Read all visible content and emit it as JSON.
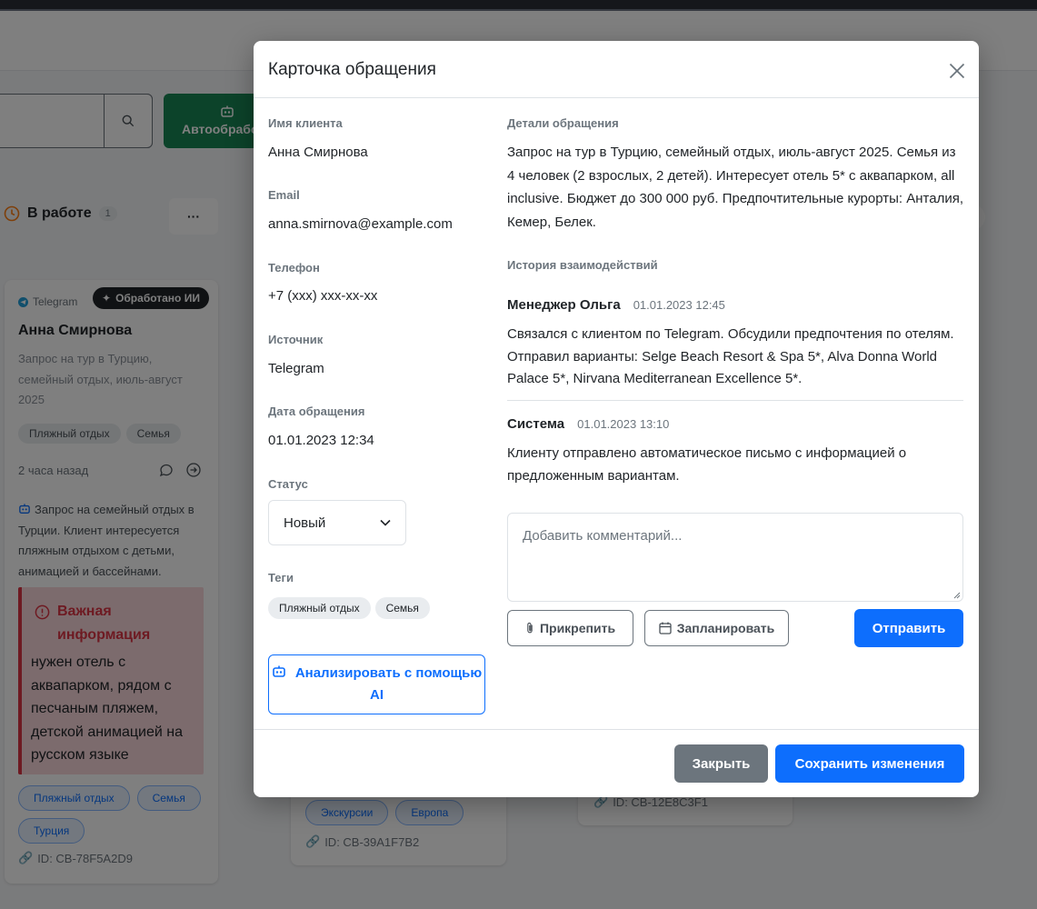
{
  "background": {
    "auto_button_label": "Автообрабо",
    "column": {
      "title": "В работе",
      "count": "1",
      "more_label": "···"
    },
    "lead_card": {
      "source": "Telegram",
      "ai_badge": "Обработано ИИ",
      "name": "Анна Смирнова",
      "description": "Запрос на тур в Турцию, семейный отдых, июль-август 2025",
      "tags": [
        "Пляжный отдых",
        "Семья"
      ],
      "time": "2 часа назад",
      "ai_summary": "Запрос на семейный отдых в Турции. Клиент интересуется пляжным отдыхом с детьми, анимацией и бассейнами.",
      "important_title": "Важная информация",
      "important_text": "нужен отель с аквапарком, рядом с песчаным пляжем, детской анимацией на русском языке",
      "tags_blue": [
        "Пляжный отдых",
        "Семья",
        "Турция"
      ],
      "id": "ID: CB-78F5A2D9"
    },
    "card2": {
      "tags": [
        "Экскурсии",
        "Европа"
      ],
      "id": "ID: CB-39A1F7B2"
    },
    "card3": {
      "id": "ID: CB-12E8C3F1"
    }
  },
  "modal": {
    "title": "Карточка обращения",
    "fields": {
      "client_name_label": "Имя клиента",
      "client_name": "Анна Смирнова",
      "email_label": "Email",
      "email": "anna.smirnova@example.com",
      "phone_label": "Телефон",
      "phone": "+7 (xxx) xxx-xx-xx",
      "source_label": "Источник",
      "source": "Telegram",
      "date_label": "Дата обращения",
      "date": "01.01.2023 12:34",
      "status_label": "Статус",
      "status": "Новый",
      "tags_label": "Теги",
      "tags": [
        "Пляжный отдых",
        "Семья"
      ]
    },
    "ai_analyze_label": "Анализировать с помощью AI",
    "details_label": "Детали обращения",
    "details_text": "Запрос на тур в Турцию, семейный отдых, июль-август 2025. Семья из 4 человек (2 взрослых, 2 детей). Интересует отель 5* с аквапарком, all inclusive. Бюджет до 300 000 руб. Предпочтительные курорты: Анталия, Кемер, Белек.",
    "history_label": "История взаимодействий",
    "history": [
      {
        "author": "Менеджер Ольга",
        "time": "01.01.2023 12:45",
        "text": "Связался с клиентом по Telegram. Обсудили предпочтения по отелям. Отправил варианты: Selge Beach Resort & Spa 5*, Alva Donna World Palace 5*, Nirvana Mediterranean Excellence 5*."
      },
      {
        "author": "Система",
        "time": "01.01.2023 13:10",
        "text": "Клиенту отправлено автоматическое письмо с информацией о предложенным вариантам."
      }
    ],
    "comment_placeholder": "Добавить комментарий...",
    "attach_label": "Прикрепить",
    "schedule_label": "Запланировать",
    "send_label": "Отправить",
    "close_label": "Закрыть",
    "save_label": "Сохранить изменения"
  },
  "colors": {
    "primary": "#0d6efd",
    "secondary": "#6c757d",
    "success": "#198754",
    "danger": "#dc3545",
    "backdrop": "rgba(0,0,0,0.5)"
  }
}
